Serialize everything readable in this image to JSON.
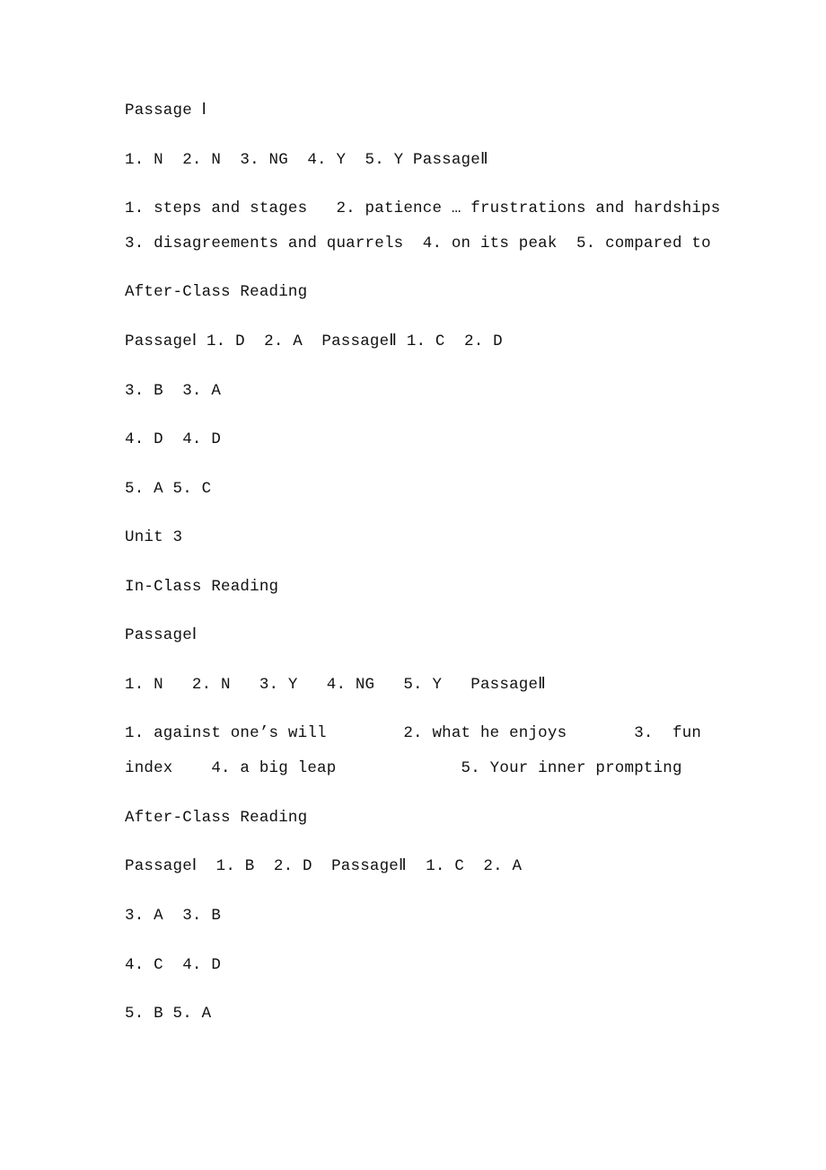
{
  "document": {
    "lines": [
      "Passage Ⅰ",
      "1. N  2. N  3. NG  4. Y  5. Y PassageⅡ",
      "1. steps and stages   2. patience … frustrations and hardships",
      "3. disagreements and quarrels  4. on its peak  5. compared to",
      "After-Class Reading",
      "PassageⅠ 1. D  2. A  PassageⅡ 1. C  2. D",
      "3. B  3. A",
      "4. D  4. D",
      "5. A 5. C",
      "Unit 3",
      "In-Class Reading",
      "PassageⅠ",
      "1. N   2. N   3. Y   4. NG   5. Y   PassageⅡ",
      "1. against one’s will        2. what he enjoys       3.  fun",
      "index    4. a big leap             5. Your inner prompting",
      "After-Class Reading",
      "PassageⅠ  1. B  2. D  PassageⅡ  1. C  2. A",
      "3. A  3. B",
      "4. C  4. D",
      "5. B 5. A"
    ]
  }
}
